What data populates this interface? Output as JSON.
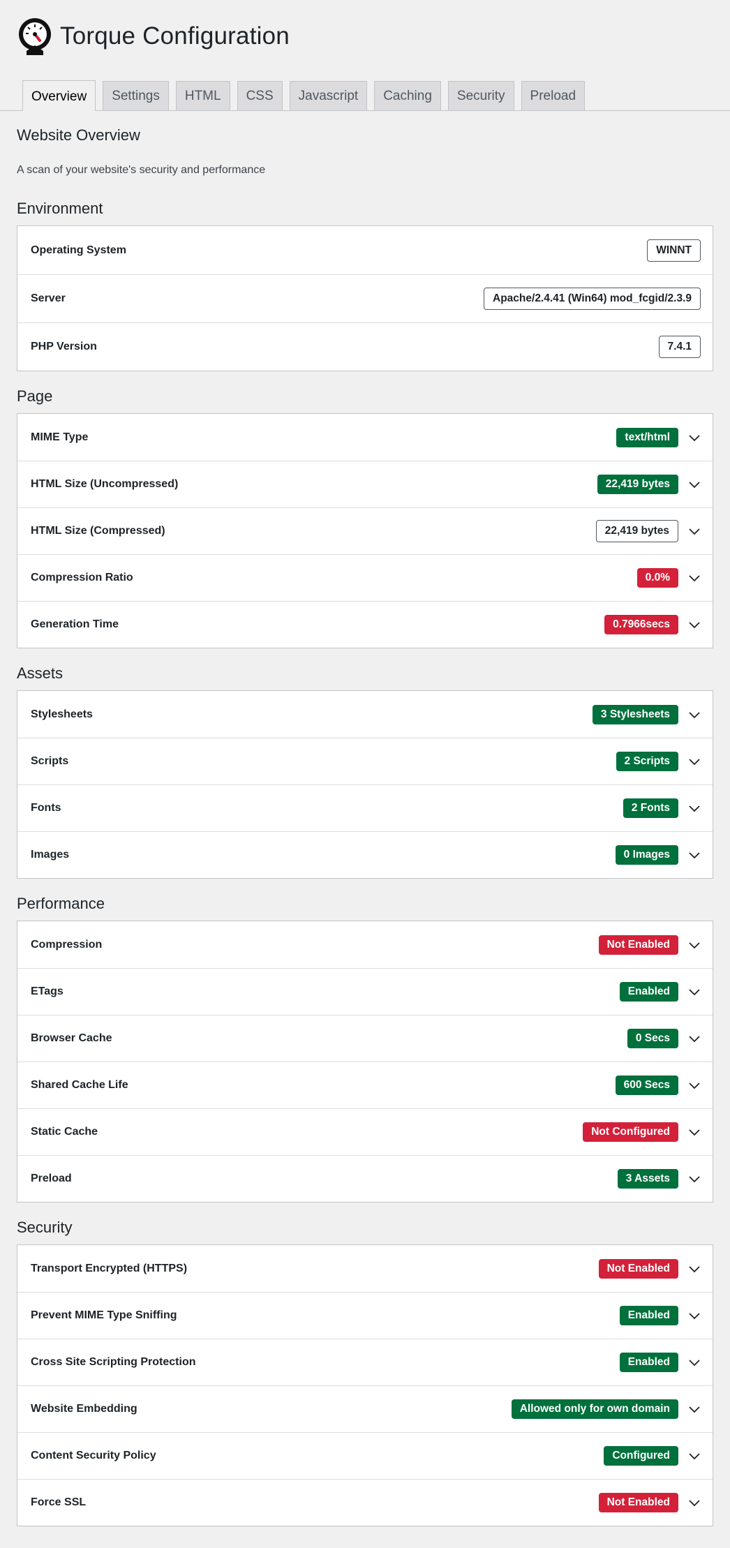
{
  "app": {
    "title": "Torque Configuration"
  },
  "icons": {
    "logo": "speedometer-logo-icon",
    "expand": "chevron-down-icon"
  },
  "colors": {
    "green": "#00703c",
    "red": "#d3213a"
  },
  "tabs": [
    {
      "label": "Overview",
      "active": true
    },
    {
      "label": "Settings",
      "active": false
    },
    {
      "label": "HTML",
      "active": false
    },
    {
      "label": "CSS",
      "active": false
    },
    {
      "label": "Javascript",
      "active": false
    },
    {
      "label": "Caching",
      "active": false
    },
    {
      "label": "Security",
      "active": false
    },
    {
      "label": "Preload",
      "active": false
    }
  ],
  "overview": {
    "heading": "Website Overview",
    "subtitle": "A scan of your website's security and performance"
  },
  "environment": {
    "heading": "Environment",
    "rows": [
      {
        "label": "Operating System",
        "value": "WINNT",
        "style": "outline"
      },
      {
        "label": "Server",
        "value": "Apache/2.4.41 (Win64) mod_fcgid/2.3.9",
        "style": "outline"
      },
      {
        "label": "PHP Version",
        "value": "7.4.1",
        "style": "outline"
      }
    ]
  },
  "page": {
    "heading": "Page",
    "rows": [
      {
        "label": "MIME Type",
        "value": "text/html",
        "style": "green"
      },
      {
        "label": "HTML Size (Uncompressed)",
        "value": "22,419 bytes",
        "style": "green"
      },
      {
        "label": "HTML Size (Compressed)",
        "value": "22,419 bytes",
        "style": "outline"
      },
      {
        "label": "Compression Ratio",
        "value": "0.0%",
        "style": "red"
      },
      {
        "label": "Generation Time",
        "value": "0.7966secs",
        "style": "red"
      }
    ]
  },
  "assets": {
    "heading": "Assets",
    "rows": [
      {
        "label": "Stylesheets",
        "value": "3 Stylesheets",
        "style": "green"
      },
      {
        "label": "Scripts",
        "value": "2 Scripts",
        "style": "green"
      },
      {
        "label": "Fonts",
        "value": "2 Fonts",
        "style": "green"
      },
      {
        "label": "Images",
        "value": "0 Images",
        "style": "green"
      }
    ]
  },
  "performance": {
    "heading": "Performance",
    "rows": [
      {
        "label": "Compression",
        "value": "Not Enabled",
        "style": "red"
      },
      {
        "label": "ETags",
        "value": "Enabled",
        "style": "green"
      },
      {
        "label": "Browser Cache",
        "value": "0 Secs",
        "style": "green"
      },
      {
        "label": "Shared Cache Life",
        "value": "600 Secs",
        "style": "green"
      },
      {
        "label": "Static Cache",
        "value": "Not Configured",
        "style": "red"
      },
      {
        "label": "Preload",
        "value": "3 Assets",
        "style": "green"
      }
    ]
  },
  "security": {
    "heading": "Security",
    "rows": [
      {
        "label": "Transport Encrypted (HTTPS)",
        "value": "Not Enabled",
        "style": "red"
      },
      {
        "label": "Prevent MIME Type Sniffing",
        "value": "Enabled",
        "style": "green"
      },
      {
        "label": "Cross Site Scripting Protection",
        "value": "Enabled",
        "style": "green"
      },
      {
        "label": "Website Embedding",
        "value": "Allowed only for own domain",
        "style": "green"
      },
      {
        "label": "Content Security Policy",
        "value": "Configured",
        "style": "green"
      },
      {
        "label": "Force SSL",
        "value": "Not Enabled",
        "style": "red"
      }
    ]
  }
}
